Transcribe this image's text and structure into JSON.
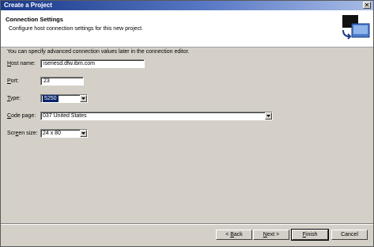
{
  "window": {
    "title": "Create a Project",
    "close_glyph": "✕"
  },
  "header": {
    "title": "Connection Settings",
    "description": "Configure host connection settings for this new project.",
    "graphic_icon": "connection-wizard-icon"
  },
  "content": {
    "info": "You can specify advanced connection values later in the connection editor.",
    "host": {
      "label_accel": "H",
      "label_rest": "ost name:",
      "value": "iseriesd.dfw.ibm.com"
    },
    "port": {
      "label_accel": "P",
      "label_rest": "ort:",
      "value": "23"
    },
    "type": {
      "label_accel": "T",
      "label_rest": "ype:",
      "value": "5250"
    },
    "code_page": {
      "label_accel": "C",
      "label_rest": "ode page:",
      "value": "037 United States"
    },
    "screen_size": {
      "label_pre": "Scr",
      "label_accel": "e",
      "label_rest": "en size:",
      "value": "24 x 80"
    }
  },
  "buttons": {
    "back": {
      "pre": "< ",
      "accel": "B",
      "rest": "ack"
    },
    "next": {
      "accel": "N",
      "rest": "ext >"
    },
    "finish": {
      "accel": "F",
      "rest": "inish"
    },
    "cancel": "Cancel"
  }
}
